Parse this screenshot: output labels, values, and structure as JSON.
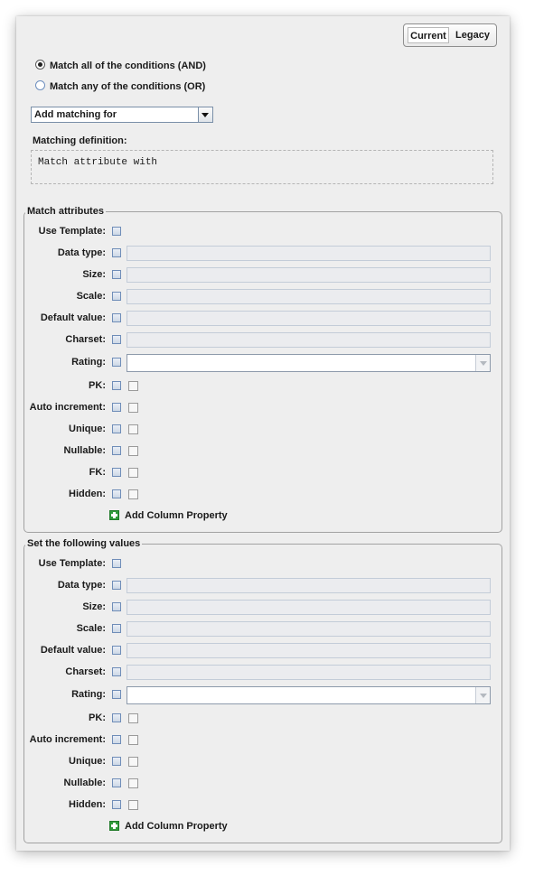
{
  "toggle": {
    "current": "Current",
    "legacy": "Legacy"
  },
  "match_mode": {
    "all": "Match all of the conditions (AND)",
    "any": "Match any of the conditions (OR)",
    "selected": "all"
  },
  "add_matching": {
    "value": "Add matching for"
  },
  "definition": {
    "label": "Matching definition:",
    "text": "Match attribute with"
  },
  "match_attributes": {
    "title": "Match attributes",
    "labels": {
      "use_template": "Use Template:",
      "data_type": "Data type:",
      "size": "Size:",
      "scale": "Scale:",
      "default_value": "Default value:",
      "charset": "Charset:",
      "rating": "Rating:",
      "pk": "PK:",
      "auto_increment": "Auto increment:",
      "unique": "Unique:",
      "nullable": "Nullable:",
      "fk": "FK:",
      "hidden": "Hidden:"
    },
    "add_property": "Add Column Property"
  },
  "set_values": {
    "title": "Set the following values",
    "labels": {
      "use_template": "Use Template:",
      "data_type": "Data type:",
      "size": "Size:",
      "scale": "Scale:",
      "default_value": "Default value:",
      "charset": "Charset:",
      "rating": "Rating:",
      "pk": "PK:",
      "auto_increment": "Auto increment:",
      "unique": "Unique:",
      "nullable": "Nullable:",
      "hidden": "Hidden:"
    },
    "add_property": "Add Column Property"
  }
}
